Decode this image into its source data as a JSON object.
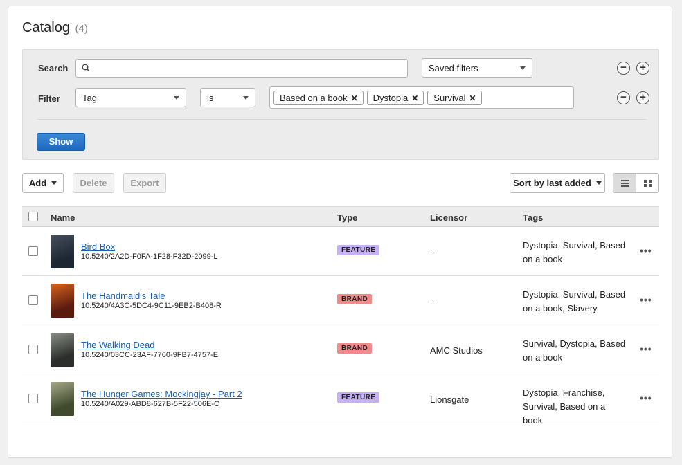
{
  "page": {
    "title": "Catalog",
    "count": "(4)"
  },
  "filters": {
    "search_label": "Search",
    "search_value": "",
    "saved_filters": "Saved filters",
    "filter_label": "Filter",
    "filter_field": "Tag",
    "filter_operator": "is",
    "filter_chips": [
      "Based on a book",
      "Dystopia",
      "Survival"
    ],
    "show_label": "Show",
    "minus": "−",
    "plus": "+"
  },
  "toolbar": {
    "add_label": "Add",
    "delete_label": "Delete",
    "export_label": "Export",
    "sort_label": "Sort by last added"
  },
  "table": {
    "columns": {
      "name": "Name",
      "type": "Type",
      "licensor": "Licensor",
      "tags": "Tags"
    },
    "rows": [
      {
        "name": "Bird Box",
        "doi": "10.5240/2A2D-F0FA-1F28-F32D-2099-L",
        "type": "FEATURE",
        "licensor": "-",
        "tags": "Dystopia, Survival, Based on a book",
        "poster_colors": [
          "#1c2733",
          "#47505c"
        ]
      },
      {
        "name": "The Handmaid's Tale",
        "doi": "10.5240/4A3C-5DC4-9C11-9EB2-B408-R",
        "type": "BRAND",
        "licensor": "-",
        "tags": "Dystopia, Survival, Based on a book, Slavery",
        "poster_colors": [
          "#5a1c0f",
          "#d8641c"
        ]
      },
      {
        "name": "The Walking Dead",
        "doi": "10.5240/03CC-23AF-7760-9FB7-4757-E",
        "type": "BRAND",
        "licensor": "AMC Studios",
        "tags": "Survival, Dystopia, Based on a book",
        "poster_colors": [
          "#2b2e2b",
          "#8a8f86"
        ]
      },
      {
        "name": "The Hunger Games: Mockingjay - Part 2",
        "doi": "10.5240/A029-ABD8-627B-5F22-506E-C",
        "type": "FEATURE",
        "licensor": "Lionsgate",
        "tags": "Dystopia, Franchise, Survival, Based on a book",
        "poster_colors": [
          "#3f4a2c",
          "#a7a98a"
        ]
      }
    ],
    "more_label": "•••"
  },
  "colors": {
    "feature_badge": "#c5b0f5",
    "brand_badge": "#f08b8b",
    "link": "#1a5fb4",
    "primary_button": "#1d68bf"
  }
}
